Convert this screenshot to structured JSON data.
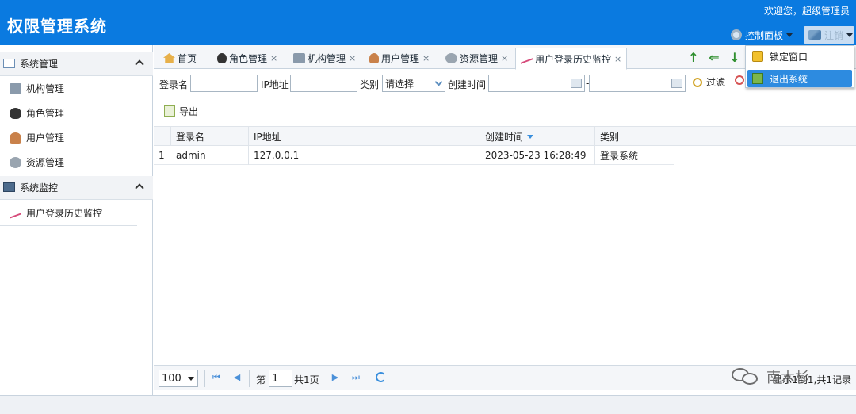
{
  "app": {
    "title": "权限管理系统",
    "welcome": "欢迎您，超级管理员"
  },
  "header": {
    "control_panel": "控制面板",
    "logout": "注销"
  },
  "logout_menu": {
    "items": [
      {
        "label": "锁定窗口"
      },
      {
        "label": "退出系统"
      }
    ]
  },
  "sidebar": {
    "groups": [
      {
        "title": "系统管理",
        "items": [
          {
            "label": "机构管理"
          },
          {
            "label": "角色管理"
          },
          {
            "label": "用户管理"
          },
          {
            "label": "资源管理"
          }
        ]
      },
      {
        "title": "系统监控",
        "items": [
          {
            "label": "用户登录历史监控"
          }
        ]
      }
    ]
  },
  "tabs": [
    {
      "label": "首页"
    },
    {
      "label": "角色管理",
      "close": "×"
    },
    {
      "label": "机构管理",
      "close": "×"
    },
    {
      "label": "用户管理",
      "close": "×"
    },
    {
      "label": "资源管理",
      "close": "×"
    },
    {
      "label": "用户登录历史监控",
      "close": "×"
    }
  ],
  "filter": {
    "login_name_label": "登录名",
    "ip_label": "IP地址",
    "category_label": "类别",
    "category_value": "请选择",
    "created_label": "创建时间",
    "range_sep": "-",
    "filter_button": "过滤"
  },
  "toolbar": {
    "export_label": "导出"
  },
  "table": {
    "columns": [
      "登录名",
      "IP地址",
      "创建时间",
      "类别"
    ],
    "rows": [
      {
        "num": "1",
        "login": "admin",
        "ip": "127.0.0.1",
        "created": "2023-05-23 16:28:49",
        "category": "登录系统"
      }
    ]
  },
  "pager": {
    "page_size": "100",
    "page_prefix": "第",
    "page_value": "1",
    "total_pages": "共1页",
    "summary": "显示1到1,共1记录"
  },
  "watermark": {
    "text": "南木杉"
  }
}
